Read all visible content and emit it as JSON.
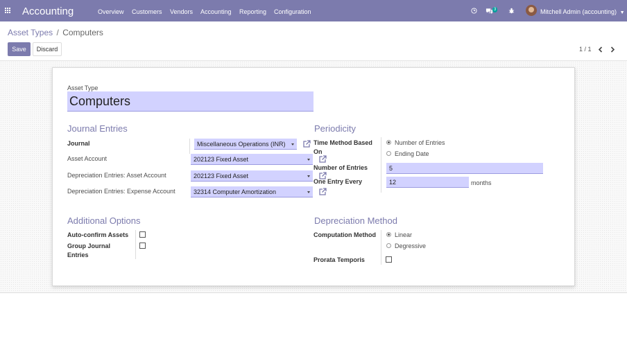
{
  "nav": {
    "app_title": "Accounting",
    "menu": [
      "Overview",
      "Customers",
      "Vendors",
      "Accounting",
      "Reporting",
      "Configuration"
    ],
    "chat_badge": "3",
    "user": "Mitchell Admin (accounting)"
  },
  "breadcrumb": {
    "parent": "Asset Types",
    "separator": "/",
    "current": "Computers"
  },
  "actions": {
    "save": "Save",
    "discard": "Discard"
  },
  "pager": {
    "value": "1 / 1"
  },
  "form": {
    "asset_type_label": "Asset Type",
    "asset_type_value": "Computers",
    "journal_entries": {
      "title": "Journal Entries",
      "journal_label": "Journal",
      "journal_value": "Miscellaneous Operations (INR)",
      "asset_account_label": "Asset Account",
      "asset_account_value": "202123 Fixed Asset",
      "dep_asset_label": "Depreciation Entries: Asset Account",
      "dep_asset_value": "202123 Fixed Asset",
      "dep_expense_label": "Depreciation Entries: Expense Account",
      "dep_expense_value": "32314 Computer Amortization"
    },
    "periodicity": {
      "title": "Periodicity",
      "time_method_label_1": "Time Method Based",
      "time_method_label_2": "On",
      "opt_entries": "Number of Entries",
      "opt_end_date": "Ending Date",
      "num_entries_label": "Number of Entries",
      "num_entries_value": "5",
      "one_entry_label": "One Entry Every",
      "one_entry_value": "12",
      "months": "months"
    },
    "additional": {
      "title": "Additional Options",
      "auto_confirm_label": "Auto-confirm Assets",
      "group_label_1": "Group Journal",
      "group_label_2": "Entries"
    },
    "depreciation": {
      "title": "Depreciation Method",
      "computation_label": "Computation Method",
      "opt_linear": "Linear",
      "opt_degressive": "Degressive",
      "prorata_label": "Prorata Temporis"
    }
  }
}
